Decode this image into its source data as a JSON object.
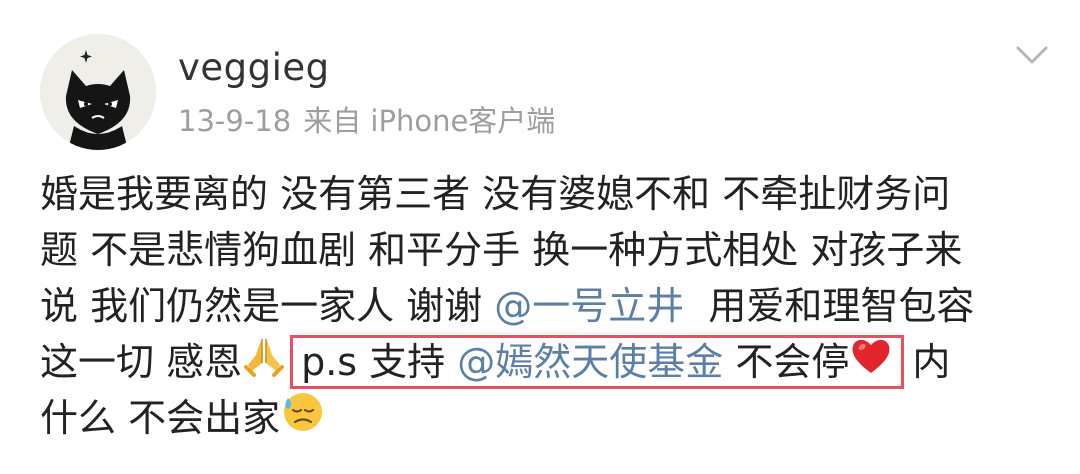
{
  "user": {
    "name": "veggieg",
    "date": "13-9-18",
    "source": "来自 iPhone客户端"
  },
  "icons": {
    "avatar": "black-cat-avatar-icon",
    "menu": "chevron-down-icon",
    "pray": "folded-hands-emoji-icon",
    "heart": "red-heart-emoji-icon",
    "sweat": "downcast-face-with-sweat-emoji-icon"
  },
  "colors": {
    "mention": "#5b7fa6",
    "highlight_border": "#e8515f",
    "meta_text": "#9e9e9e"
  },
  "post": {
    "line1": "婚是我要离的 没有第三者 没有婆媳不和 不牵扯财务问",
    "line2": "题 不是悲情狗血剧 和平分手 换一种方式相处 对孩子来",
    "line3_a": "说 我们仍然是一家人 谢谢 ",
    "line3_mention": "@一号立井",
    "line3_b": "  用爱和理智包容",
    "line4_a": "这一切 感恩",
    "line4_ps": "p.s 支持 ",
    "line4_mention": "@嫣然天使基金",
    "line4_b": " 不会停",
    "line4_c": "内",
    "line5": "什么 不会出家"
  }
}
